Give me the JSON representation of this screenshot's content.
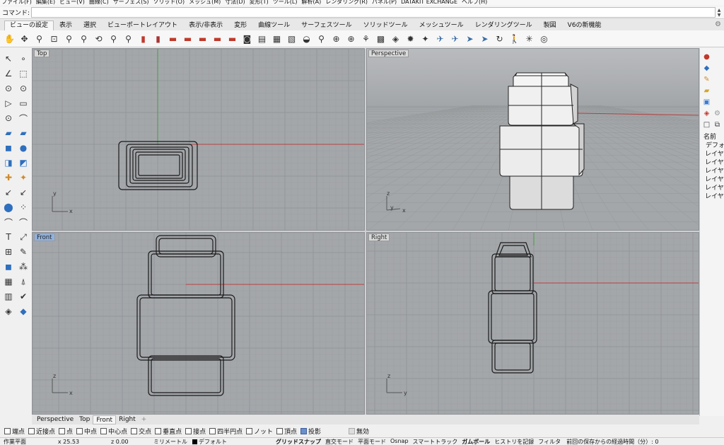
{
  "menu": [
    "ファイル(F)",
    "編集(E)",
    "ビュー(V)",
    "曲線(C)",
    "サーフェス(S)",
    "ソリッド(O)",
    "メッシュ(M)",
    "寸法(D)",
    "変形(T)",
    "ツール(L)",
    "解析(A)",
    "レンダリング(R)",
    "パネル(P)",
    "DATAKIT EXCHANGE",
    "ヘルプ(H)"
  ],
  "command": {
    "label": "コマンド:",
    "value": ""
  },
  "tabs": [
    "ビューの設定",
    "表示",
    "選択",
    "ビューポートレイアウト",
    "表示/非表示",
    "変形",
    "曲線ツール",
    "サーフェスツール",
    "ソリッドツール",
    "メッシュツール",
    "レンダリングツール",
    "製図",
    "V6の新機能"
  ],
  "active_tab": "ビューの設定",
  "toolbar_icons": [
    "hand-pan-icon",
    "move-icon",
    "zoom-icon",
    "zoom-window-icon",
    "zoom-extents-icon",
    "zoom-selected-icon",
    "rotate-view-icon",
    "zoom-dynamic-icon",
    "zoom-target-icon",
    "render-icon",
    "render-preview-icon",
    "car-icon",
    "car-icon",
    "car-icon",
    "car-icon",
    "car-icon",
    "camera-icon",
    "camera-set-icon",
    "named-view-icon",
    "layout-icon",
    "lens-icon",
    "zoom-out-icon",
    "target-icon",
    "target-icon",
    "walk-icon",
    "cplane-icon",
    "box-view-icon",
    "sun-icon",
    "lights-icon",
    "wing-icon",
    "wing-icon",
    "plane-icon",
    "plane-icon",
    "rotate-icon",
    "walkabout-icon",
    "light-spot-icon",
    "snapshot-icon"
  ],
  "viewports": {
    "top": {
      "label": "Top",
      "axis_a": "y",
      "axis_b": "x"
    },
    "perspective": {
      "label": "Perspective",
      "axis_a": "z",
      "axis_b": "y",
      "axis_c": "x"
    },
    "front": {
      "label": "Front",
      "axis_a": "z",
      "axis_b": "x"
    },
    "right": {
      "label": "Right",
      "axis_a": "z",
      "axis_b": "y"
    }
  },
  "right_panel": {
    "header": "名前",
    "items": [
      "デフォ",
      "レイヤ",
      "レイヤ",
      "レイヤ",
      "レイヤ",
      "レイヤ",
      "レイヤ"
    ]
  },
  "viewport_tabs": [
    "Perspective",
    "Top",
    "Front",
    "Right"
  ],
  "active_viewport_tab": "Front",
  "osnap": [
    {
      "label": "端点",
      "checked": false
    },
    {
      "label": "近接点",
      "checked": false
    },
    {
      "label": "点",
      "checked": false
    },
    {
      "label": "中点",
      "checked": false
    },
    {
      "label": "中心点",
      "checked": false
    },
    {
      "label": "交点",
      "checked": false
    },
    {
      "label": "垂直点",
      "checked": false
    },
    {
      "label": "接点",
      "checked": false
    },
    {
      "label": "四半円点",
      "checked": false
    },
    {
      "label": "ノット",
      "checked": false
    },
    {
      "label": "頂点",
      "checked": false
    },
    {
      "label": "投影",
      "checked": true
    }
  ],
  "osnap_disable": "無効",
  "status": {
    "cplane": "作業平面",
    "x": "x 25.53",
    "z": "z 0.00",
    "unit": "ミリメートル",
    "layer": "デフォルト",
    "items": [
      "グリッドスナップ",
      "直交モード",
      "平面モード",
      "Osnap",
      "スマートトラック",
      "ガムボール",
      "ヒストリを記録",
      "フィルタ"
    ],
    "save_text": "前回の保存からの経過時間（分）: 0"
  },
  "colors": {
    "viewport_bg": "#a4a7aa",
    "grid": "#9a9da0",
    "axis_red": "#b84040",
    "axis_green": "#40a040",
    "active_label": "#8fb3e3"
  }
}
